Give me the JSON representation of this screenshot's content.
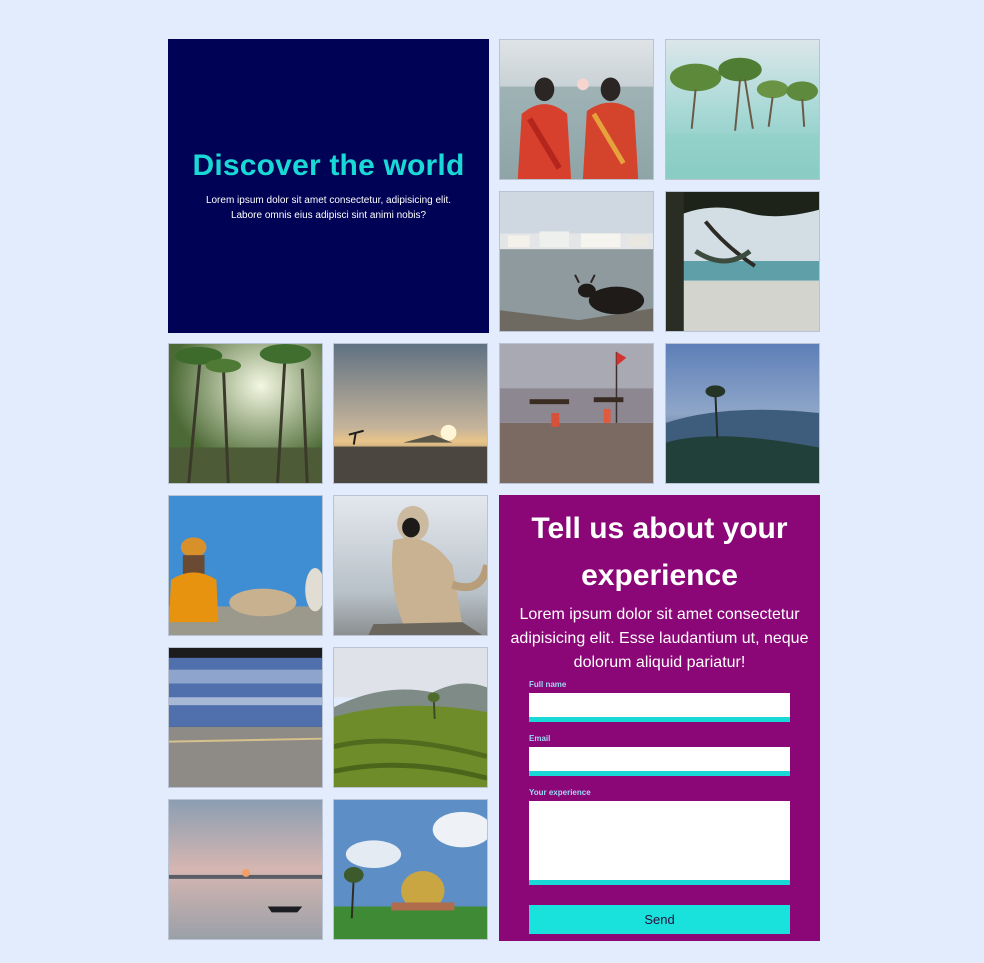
{
  "hero": {
    "title": "Discover the world",
    "text": "Lorem ipsum dolor sit amet consectetur, adipisicing elit. Labore omnis eius adipisci sint animi nobis?"
  },
  "gallery": [
    {
      "name": "women-in-saris-photo"
    },
    {
      "name": "mangrove-trees-photo"
    },
    {
      "name": "riverside-town-cow-photo"
    },
    {
      "name": "beach-hammock-photo"
    },
    {
      "name": "palm-forest-photo"
    },
    {
      "name": "sunset-tidal-flat-photo"
    },
    {
      "name": "beach-flag-walkers-photo"
    },
    {
      "name": "misty-mountain-photo"
    },
    {
      "name": "sadhu-blue-wall-photo"
    },
    {
      "name": "langur-monkey-photo"
    },
    {
      "name": "moving-train-photo"
    },
    {
      "name": "tea-plantation-photo"
    },
    {
      "name": "sunset-boat-photo"
    },
    {
      "name": "golden-dome-photo"
    }
  ],
  "form": {
    "title": "Tell us about your experience",
    "intro": "Lorem ipsum dolor sit amet consectetur adipisicing elit. Esse laudantium ut, neque dolorum aliquid pariatur!",
    "fields": {
      "full_name": {
        "label": "Full name",
        "value": ""
      },
      "email": {
        "label": "Email",
        "value": ""
      },
      "experience": {
        "label": "Your experience",
        "value": ""
      }
    },
    "submit_label": "Send"
  },
  "colors": {
    "background": "#e3ecfd",
    "hero_bg": "#000255",
    "accent": "#19d9d7",
    "panel_bg": "#8b0677"
  }
}
